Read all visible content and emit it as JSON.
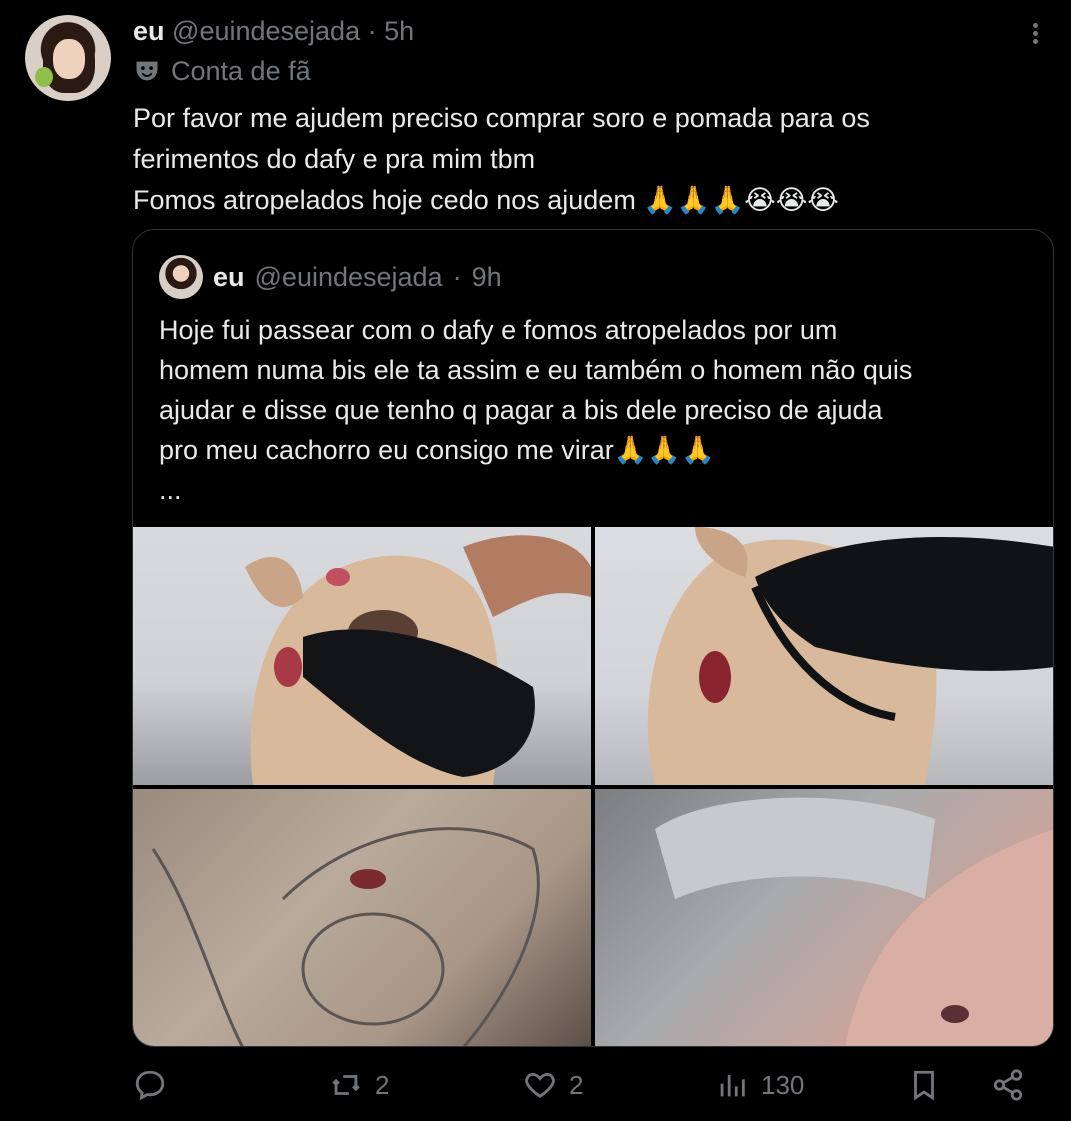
{
  "tweet": {
    "name": "eu",
    "handle": "@euindesejada",
    "time": "5h",
    "label": "Conta de fã",
    "text_lines": [
      "Por favor me ajudem preciso comprar soro e pomada para os",
      "ferimentos do dafy e pra mim tbm",
      "Fomos atropelados hoje cedo nos ajudem 🙏🙏🙏😭😭😭"
    ]
  },
  "quote": {
    "name": "eu",
    "handle": "@euindesejada",
    "time": "9h",
    "text_lines": [
      "Hoje fui passear com o dafy e fomos atropelados por um",
      "homem numa bis ele ta assim e eu também o homem não quis",
      "ajudar e disse que tenho q pagar a bis dele preciso de ajuda",
      "pro meu cachorro eu consigo me virar🙏🙏🙏",
      "..."
    ]
  },
  "actions": {
    "reply_count": "",
    "retweet_count": "2",
    "like_count": "2",
    "views_count": "130"
  },
  "icons": {
    "more": "more-icon",
    "label": "theater-mask-icon",
    "reply": "reply-icon",
    "retweet": "retweet-icon",
    "like": "heart-icon",
    "views": "views-icon",
    "bookmark": "bookmark-icon",
    "share": "share-icon"
  },
  "colors": {
    "background": "#000000",
    "text": "#e7e9ea",
    "muted": "#71767b",
    "border": "#2f3336"
  }
}
